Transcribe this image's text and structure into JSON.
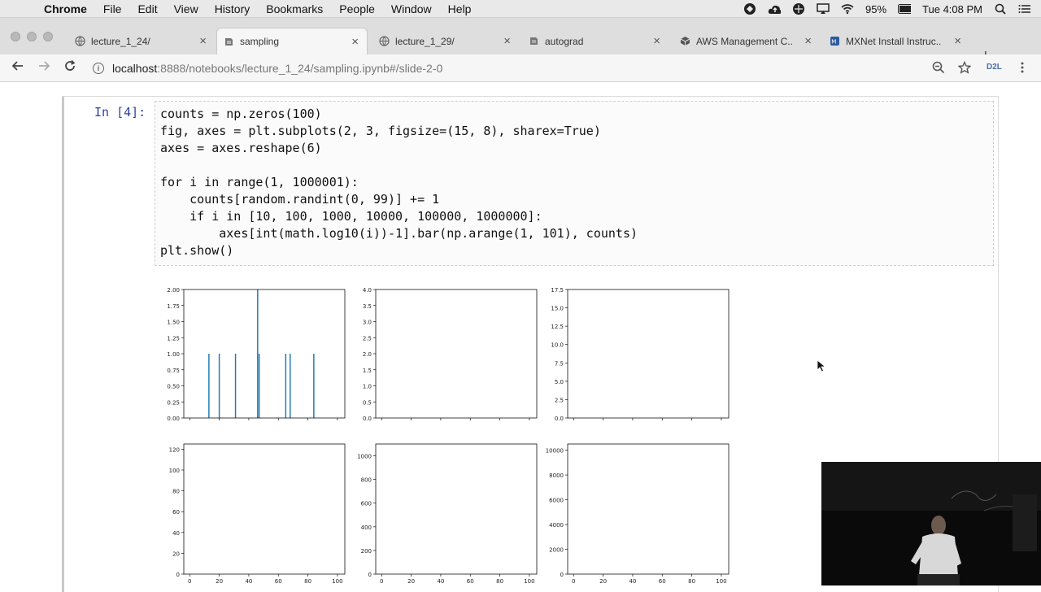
{
  "menubar": {
    "apple": "",
    "items": [
      "Chrome",
      "File",
      "Edit",
      "View",
      "History",
      "Bookmarks",
      "People",
      "Window",
      "Help"
    ],
    "battery": "95%",
    "clock": "Tue 4:08 PM"
  },
  "tabs": [
    {
      "label": "lecture_1_24/",
      "active": false
    },
    {
      "label": "sampling",
      "active": true
    },
    {
      "label": "lecture_1_29/",
      "active": false
    },
    {
      "label": "autograd",
      "active": false
    },
    {
      "label": "AWS Management C...",
      "active": false
    },
    {
      "label": "MXNet Install Instruc...",
      "active": false
    }
  ],
  "address": {
    "host": "localhost",
    "path": ":8888/notebooks/lecture_1_24/sampling.ipynb#/slide-2-0"
  },
  "toolbar": {
    "d2l": "D2L"
  },
  "cell": {
    "prompt": "In [4]:",
    "code": [
      "counts = np.zeros(100)",
      "fig, axes = plt.subplots(2, 3, figsize=(15, 8), sharex=True)",
      "axes = axes.reshape(6)",
      "",
      "for i in range(1, 1000001):",
      "    counts[random.randint(0, 99)] += 1",
      "    if i in [10, 100, 1000, 10000, 100000, 1000000]:",
      "        axes[int(math.log10(i))-1].bar(np.arange(1, 101), counts)",
      "plt.show()"
    ]
  },
  "chart_data": [
    {
      "type": "bar",
      "ylim": [
        0,
        2.0
      ],
      "yticks": [
        "0.00",
        "0.25",
        "0.50",
        "0.75",
        "1.00",
        "1.25",
        "1.50",
        "1.75",
        "2.00"
      ],
      "x": [
        13,
        20,
        31,
        46,
        47,
        65,
        68,
        84
      ],
      "values": [
        1,
        1,
        1,
        2,
        1,
        1,
        1,
        1
      ]
    },
    {
      "type": "bar",
      "ylim": [
        0,
        4.0
      ],
      "yticks": [
        "0.0",
        "0.5",
        "1.0",
        "1.5",
        "2.0",
        "2.5",
        "3.0",
        "3.5",
        "4.0"
      ],
      "x": [],
      "values": []
    },
    {
      "type": "bar",
      "ylim": [
        0,
        17.5
      ],
      "yticks": [
        "0.0",
        "2.5",
        "5.0",
        "7.5",
        "10.0",
        "12.5",
        "15.0",
        "17.5"
      ],
      "x": [],
      "values": []
    },
    {
      "type": "bar",
      "ylim": [
        0,
        125
      ],
      "yticks": [
        "0",
        "20",
        "40",
        "60",
        "80",
        "100",
        "120"
      ],
      "xticks": [
        "0",
        "20",
        "40",
        "60",
        "80",
        "100"
      ],
      "x": [],
      "values": []
    },
    {
      "type": "bar",
      "ylim": [
        0,
        1100
      ],
      "yticks": [
        "0",
        "200",
        "400",
        "600",
        "800",
        "1000"
      ],
      "xticks": [
        "0",
        "20",
        "40",
        "60",
        "80",
        "100"
      ],
      "x": [],
      "values": []
    },
    {
      "type": "bar",
      "ylim": [
        0,
        10500
      ],
      "yticks": [
        "0",
        "2000",
        "4000",
        "6000",
        "8000",
        "10000"
      ],
      "xticks": [
        "0",
        "20",
        "40",
        "60",
        "80",
        "100"
      ],
      "x": [],
      "values": []
    }
  ],
  "colors": {
    "bar": "#1f77b4",
    "prompt": "#303f9f"
  }
}
